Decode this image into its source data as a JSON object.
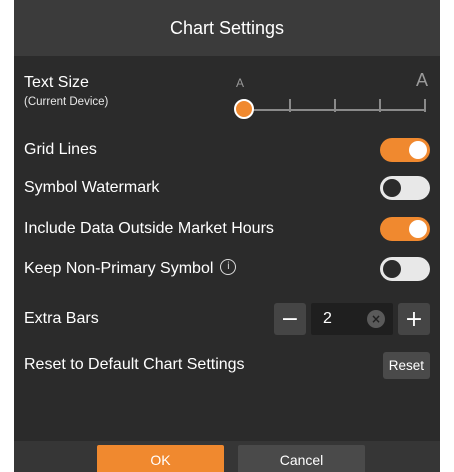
{
  "dialog": {
    "title": "Chart Settings"
  },
  "text_size": {
    "label": "Text Size",
    "sublabel": "(Current Device)",
    "small_glyph": "A",
    "large_glyph": "A",
    "level_index": 0,
    "level_count": 5
  },
  "grid_lines": {
    "label": "Grid Lines",
    "on": true
  },
  "symbol_watermark": {
    "label": "Symbol Watermark",
    "on": false
  },
  "include_outside_hours": {
    "label": "Include Data Outside Market Hours",
    "on": true
  },
  "keep_non_primary": {
    "label": "Keep Non-Primary Symbol",
    "info_glyph": "i",
    "on": false
  },
  "extra_bars": {
    "label": "Extra Bars",
    "value": "2",
    "minus": "−",
    "plus": "+",
    "clear": "×"
  },
  "reset": {
    "label": "Reset to Default Chart Settings",
    "button": "Reset"
  },
  "footer": {
    "ok": "OK",
    "cancel": "Cancel"
  },
  "colors": {
    "accent": "#f0892f",
    "panel": "#2b2b2b",
    "header": "#3b3b3b"
  }
}
